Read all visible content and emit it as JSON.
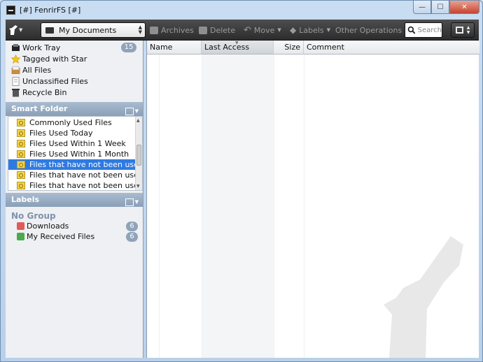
{
  "window": {
    "title": "[#] FenrirFS [#]"
  },
  "toolbar": {
    "folder": "My Documents",
    "buttons": {
      "archives": "Archives",
      "delete": "Delete",
      "move": "Move",
      "labels": "Labels",
      "other": "Other Operations"
    },
    "search_placeholder": "Search"
  },
  "nav": {
    "items": [
      {
        "label": "Work Tray",
        "count": "15",
        "icon": "tray-icon"
      },
      {
        "label": "Tagged with Star",
        "icon": "star-icon"
      },
      {
        "label": "All Files",
        "icon": "all-files-icon"
      },
      {
        "label": "Unclassified Files",
        "icon": "unclassified-icon"
      },
      {
        "label": "Recycle Bin",
        "icon": "trash-icon"
      }
    ]
  },
  "smart_folder": {
    "title": "Smart Folder",
    "items": [
      "Commonly Used Files",
      "Files Used Today",
      "Files Used Within 1 Week",
      "Files Used Within 1 Month",
      "Files that have not been used f...",
      "Files that have not been used f...",
      "Files that have not been used f..."
    ],
    "selected_index": 4
  },
  "labels": {
    "title": "Labels",
    "group": "No Group",
    "items": [
      {
        "label": "Downloads",
        "count": "6",
        "color": "#e05a5a"
      },
      {
        "label": "My Received Files",
        "count": "6",
        "color": "#4caa4c"
      }
    ]
  },
  "file_list": {
    "columns": [
      "Name",
      "Last Access",
      "Size",
      "Comment"
    ],
    "sorted_column": "Last Access"
  },
  "colors": {
    "accent": "#2f7ae0",
    "toolbar": "#2c2c2c",
    "badge": "#8fa3b9"
  }
}
